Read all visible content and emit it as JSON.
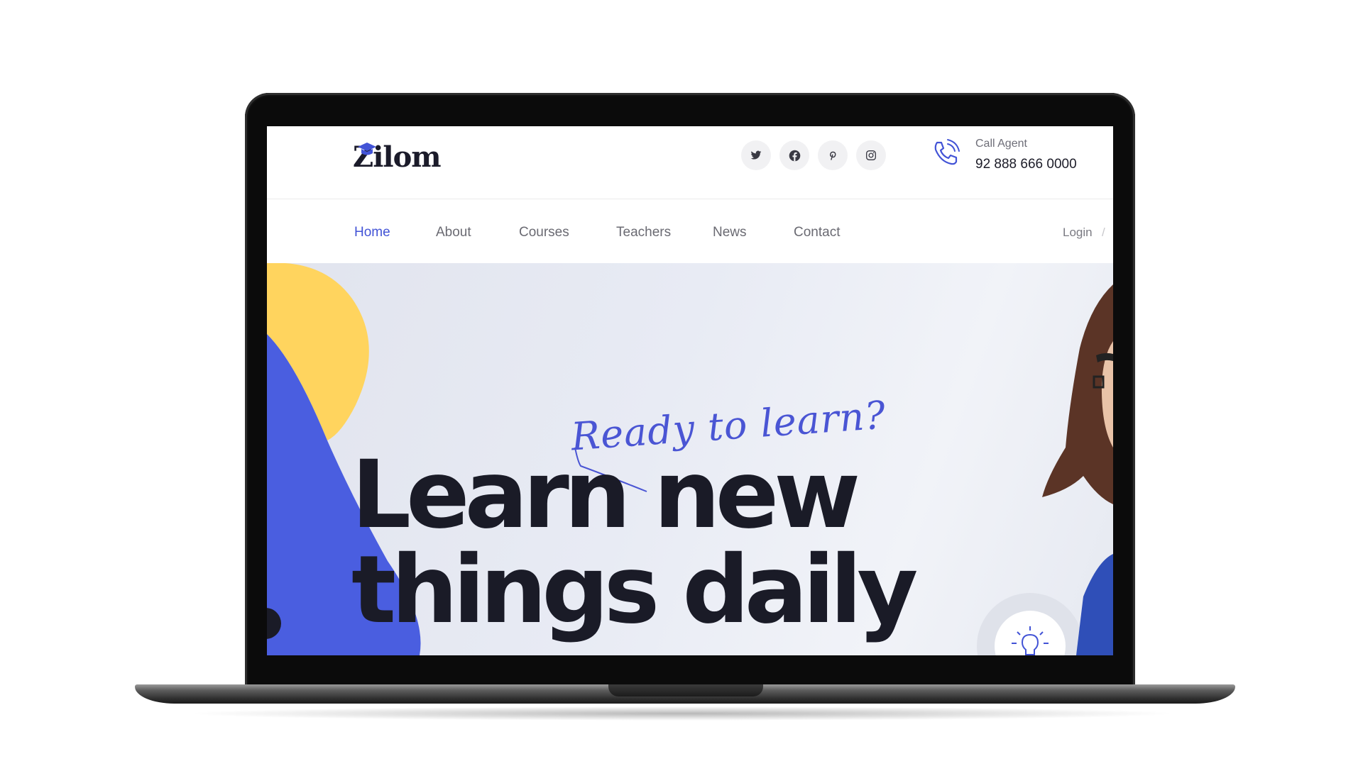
{
  "brand": {
    "logo_text": "Zilom"
  },
  "socials": [
    {
      "icon": "twitter-icon"
    },
    {
      "icon": "facebook-icon"
    },
    {
      "icon": "pinterest-icon"
    },
    {
      "icon": "instagram-icon"
    }
  ],
  "contact": {
    "label": "Call Agent",
    "phone": "92 888 666 0000",
    "icon": "phone-icon"
  },
  "nav": {
    "items": [
      {
        "label": "Home",
        "active": true
      },
      {
        "label": "About"
      },
      {
        "label": "Courses"
      },
      {
        "label": "Teachers"
      },
      {
        "label": "News"
      },
      {
        "label": "Contact"
      }
    ],
    "login": "Login",
    "login_separator": "/"
  },
  "hero": {
    "tagline": "Ready to learn?",
    "headline_line1": "Learn new",
    "headline_line2": "things daily",
    "badge_icon": "lightbulb-icon"
  },
  "colors": {
    "accent": "#4253d6",
    "yellow_shape": "#ffd45e",
    "blue_shape": "#4a5ee0",
    "heading": "#1a1b27"
  }
}
